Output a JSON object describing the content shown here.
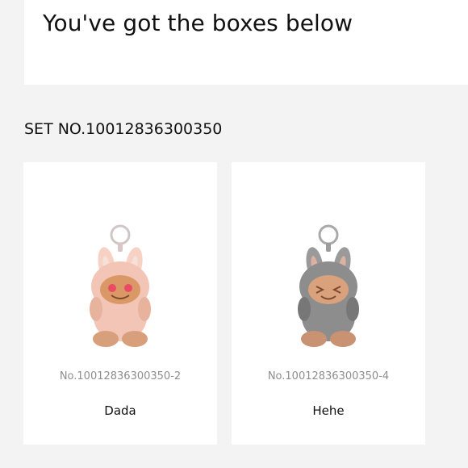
{
  "header": {
    "title": "You've got the boxes below"
  },
  "set": {
    "title": "SET NO.10012836300350"
  },
  "boxes": [
    {
      "number": "No.10012836300350-2",
      "name": "Dada",
      "image": "pink-plush-keychain-figure",
      "color": "#f3c5b6"
    },
    {
      "number": "No.10012836300350-4",
      "name": "Hehe",
      "image": "gray-plush-keychain-figure",
      "color": "#8d8d8d"
    }
  ]
}
